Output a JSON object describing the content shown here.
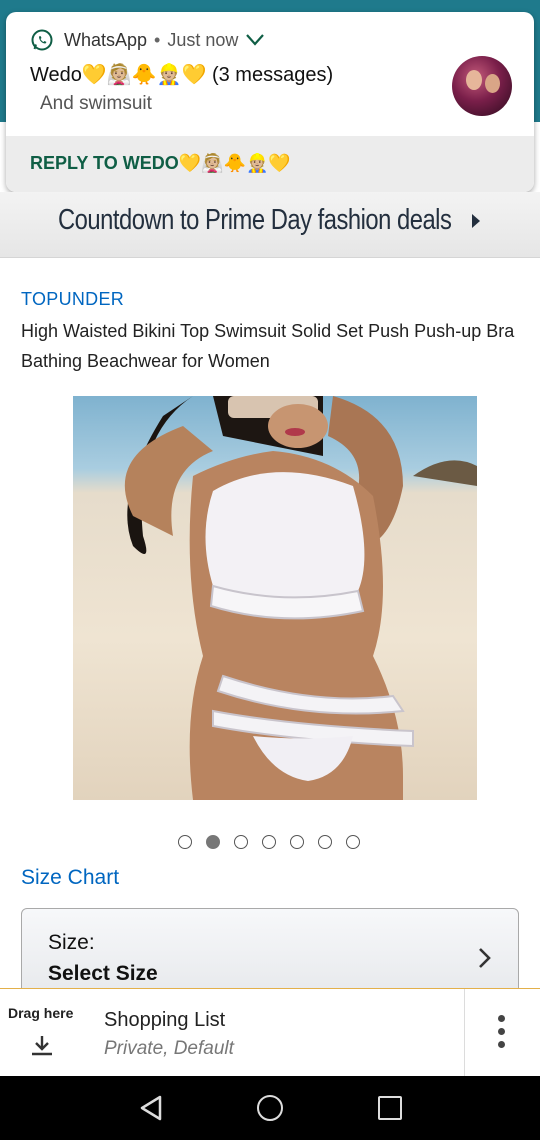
{
  "notification": {
    "app_name": "WhatsApp",
    "separator": "•",
    "time": "Just now",
    "title": "Wedo💛👰🏼🐥👷🏼💛 (3 messages)",
    "text": "And swimsuit",
    "reply_label": "REPLY TO WEDO💛👰🏼🐥👷🏼💛",
    "icon": "whatsapp-icon"
  },
  "banner": {
    "text": "Countdown to Prime Day fashion deals"
  },
  "product": {
    "brand": "TOPUNDER",
    "title": "High Waisted Bikini Top Swimsuit Solid Set Push Push-up Bra Bathing Beachwear for Women",
    "image_count": 7,
    "active_image_index": 1,
    "size_chart_label": "Size Chart",
    "size_label": "Size:",
    "size_value": "Select Size"
  },
  "shopping_list": {
    "drag_label": "Drag here",
    "title": "Shopping List",
    "subtitle": "Private, Default"
  },
  "colors": {
    "link": "#0066c0",
    "whatsapp_green": "#0f5e45",
    "header_teal": "#1f7a8c"
  }
}
